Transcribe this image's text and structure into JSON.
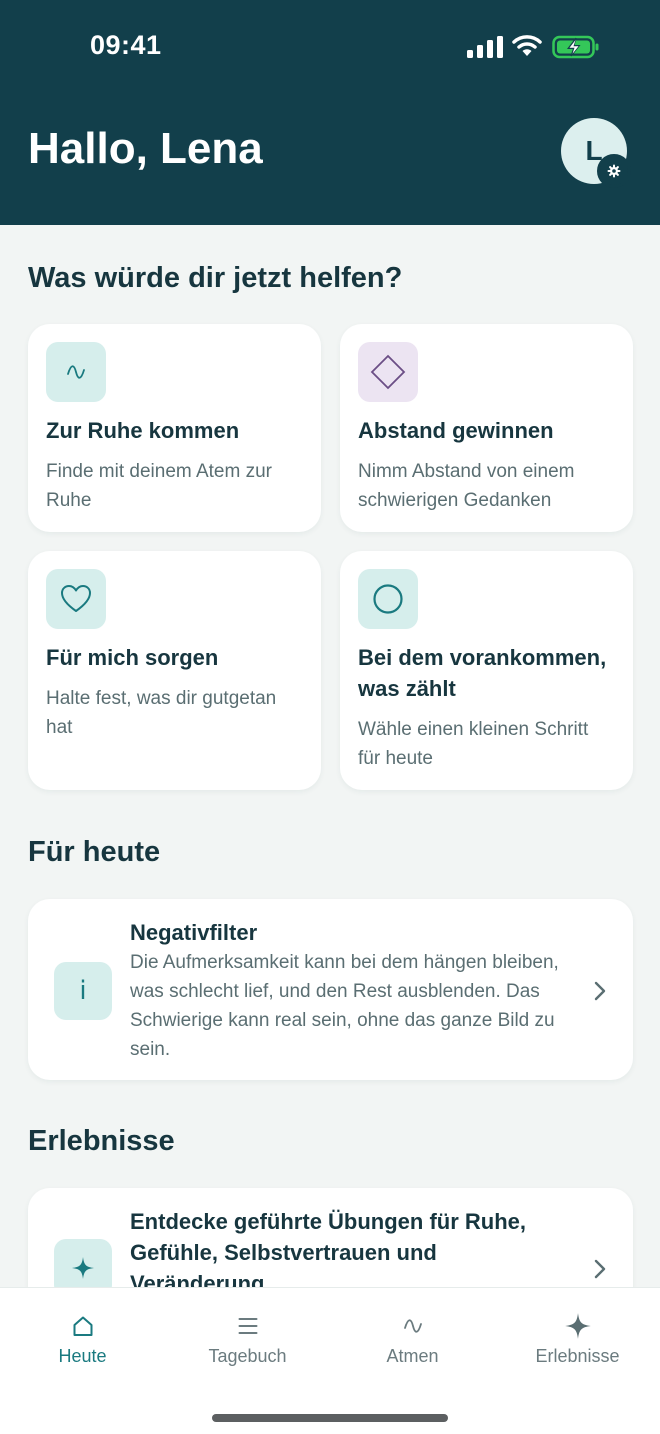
{
  "status_bar": {
    "time": "09:41"
  },
  "header": {
    "greeting": "Hallo, Lena",
    "avatar_initial": "L"
  },
  "help_section": {
    "title": "Was würde dir jetzt helfen?",
    "tiles": [
      {
        "title": "Zur Ruhe kommen",
        "description": "Finde mit deinem Atem zur Ruhe",
        "icon": "wave-icon",
        "icon_bg": "#d6eeec",
        "icon_color": "#1a7a80"
      },
      {
        "title": "Abstand gewinnen",
        "description": "Nimm Abstand von einem schwierigen Gedanken",
        "icon": "diamond-icon",
        "icon_bg": "#ece4f2",
        "icon_color": "#6b4e86"
      },
      {
        "title": "Für mich sorgen",
        "description": "Halte fest, was dir gutgetan hat",
        "icon": "heart-icon",
        "icon_bg": "#d6eeec",
        "icon_color": "#1a7a80"
      },
      {
        "title": "Bei dem vorankommen, was zählt",
        "description": "Wähle einen kleinen Schritt für heute",
        "icon": "circle-icon",
        "icon_bg": "#d6eeec",
        "icon_color": "#1a7a80"
      }
    ]
  },
  "today_section": {
    "title": "Für heute",
    "card": {
      "icon_text": "i",
      "title": "Negativfilter",
      "body": "Die Aufmerksamkeit kann bei dem hängen bleiben, was schlecht lief, und den Rest ausblenden. Das Schwierige kann real sein, ohne das ganze Bild zu sein."
    }
  },
  "experiences_section": {
    "title": "Erlebnisse",
    "card": {
      "title": "Entdecke geführte Übungen für Ruhe, Gefühle, Selbstvertrauen und Veränderung"
    }
  },
  "tabbar": {
    "tabs": [
      {
        "label": "Heute",
        "icon": "home-icon",
        "active": true
      },
      {
        "label": "Tagebuch",
        "icon": "list-icon",
        "active": false
      },
      {
        "label": "Atmen",
        "icon": "wave-icon",
        "active": false
      },
      {
        "label": "Erlebnisse",
        "icon": "sparkle-icon",
        "active": false
      }
    ]
  },
  "colors": {
    "header_bg": "#123f4b",
    "accent": "#1a7a80",
    "page_bg": "#f2f5f4",
    "battery": "#34c759"
  }
}
